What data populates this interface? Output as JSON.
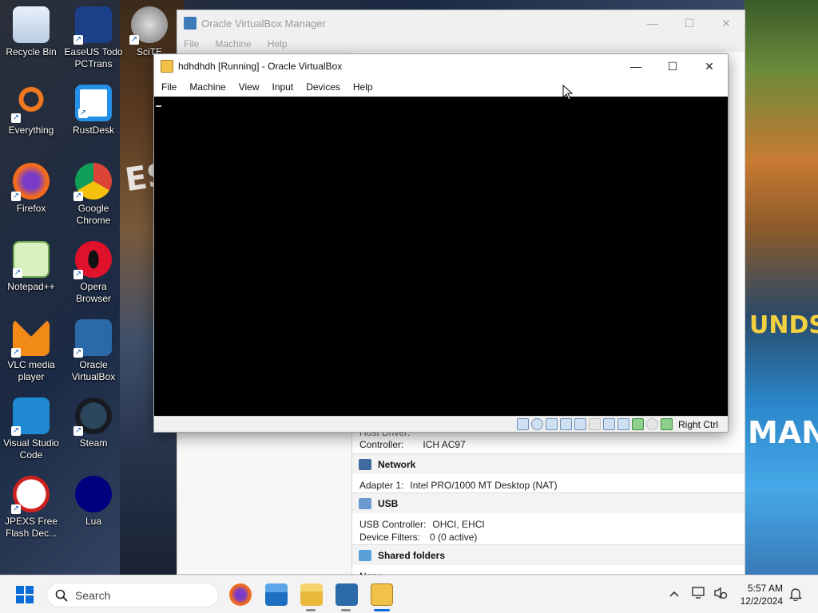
{
  "desktop": {
    "icons": [
      {
        "label": "Recycle Bin",
        "icon": "recycle-bin-icon"
      },
      {
        "label": "EaseUS Todo PCTrans",
        "icon": "easeus-icon"
      },
      {
        "label": "SciTE",
        "icon": "scite-icon"
      },
      {
        "label": "Everything",
        "icon": "everything-icon"
      },
      {
        "label": "RustDesk",
        "icon": "rustdesk-icon"
      },
      {
        "label": "Firefox",
        "icon": "firefox-icon"
      },
      {
        "label": "Google Chrome",
        "icon": "chrome-icon"
      },
      {
        "label": "Notepad++",
        "icon": "notepadpp-icon"
      },
      {
        "label": "Opera Browser",
        "icon": "opera-icon"
      },
      {
        "label": "VLC media player",
        "icon": "vlc-icon"
      },
      {
        "label": "Oracle VirtualBox",
        "icon": "virtualbox-icon"
      },
      {
        "label": "Visual Studio Code",
        "icon": "vscode-icon"
      },
      {
        "label": "Steam",
        "icon": "steam-icon"
      },
      {
        "label": "JPEXS Free Flash Dec...",
        "icon": "jpexs-icon"
      },
      {
        "label": "Lua",
        "icon": "lua-icon"
      }
    ]
  },
  "manager": {
    "title": "Oracle VirtualBox Manager",
    "menu": [
      "File",
      "Machine",
      "Help"
    ],
    "audio": {
      "host_driver": "Host Driver:",
      "controller_label": "Controller:",
      "controller_value": "ICH AC97"
    },
    "network": {
      "title": "Network",
      "adapter_label": "Adapter 1:",
      "adapter_value": "Intel PRO/1000 MT Desktop (NAT)"
    },
    "usb": {
      "title": "USB",
      "controller_label": "USB Controller:",
      "controller_value": "OHCI, EHCI",
      "filters_label": "Device Filters:",
      "filters_value": "0 (0 active)"
    },
    "shared": {
      "title": "Shared folders",
      "value": "None"
    }
  },
  "vm_window": {
    "title": "hdhdhdh [Running] - Oracle VirtualBox",
    "menu": [
      "File",
      "Machine",
      "View",
      "Input",
      "Devices",
      "Help"
    ],
    "host_key": "Right Ctrl"
  },
  "taskbar": {
    "search_placeholder": "Search",
    "apps": [
      "firefox-icon",
      "file-explorer-icon",
      "folder-icon",
      "virtualbox-icon",
      "vm-window-icon"
    ],
    "time": "5:57 AM",
    "date": "12/2/2024"
  }
}
